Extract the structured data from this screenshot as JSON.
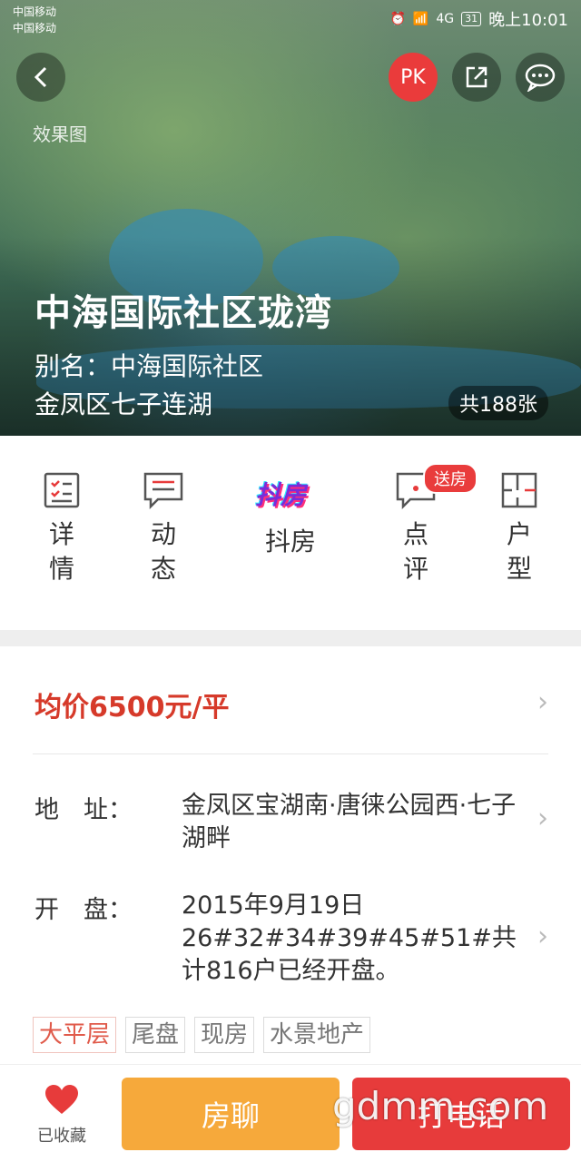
{
  "status": {
    "carrier1": "中国移动",
    "carrier2": "中国移动",
    "network": "4G",
    "battery": "31",
    "time": "晚上10:01"
  },
  "hero": {
    "effect_label": "效果图",
    "title": "中海国际社区珑湾",
    "alias": "别名：中海国际社区",
    "location": "金凤区七子连湖",
    "photo_count": "共188张",
    "pk_label": "PK"
  },
  "nav": {
    "items": [
      {
        "label": "详情",
        "icon": "checklist-icon"
      },
      {
        "label": "动态",
        "icon": "message-lines-icon"
      },
      {
        "label": "抖房",
        "icon": "douyin-logo"
      },
      {
        "label": "点评",
        "icon": "comment-icon",
        "badge": "送房"
      },
      {
        "label": "户型",
        "icon": "floorplan-icon"
      }
    ],
    "douyin_logo_text": "抖房"
  },
  "info": {
    "price": "均价6500元/平",
    "address_label": "地　址：",
    "address_value": "金凤区宝湖南·唐徕公园西·七子湖畔",
    "opening_label": "开　盘：",
    "opening_value": "2015年9月19日26#32#34#39#45#51#共计816户已经开盘。",
    "tags": [
      "大平层",
      "尾盘",
      "现房",
      "水景地产"
    ]
  },
  "bottom": {
    "favorite_label": "已收藏",
    "chat_label": "房聊",
    "call_label": "打电话",
    "watermark": "gdmm.com"
  },
  "colors": {
    "accent_red": "#e73b3b",
    "price_red": "#d63a2a",
    "chat_orange": "#f6a93b"
  }
}
